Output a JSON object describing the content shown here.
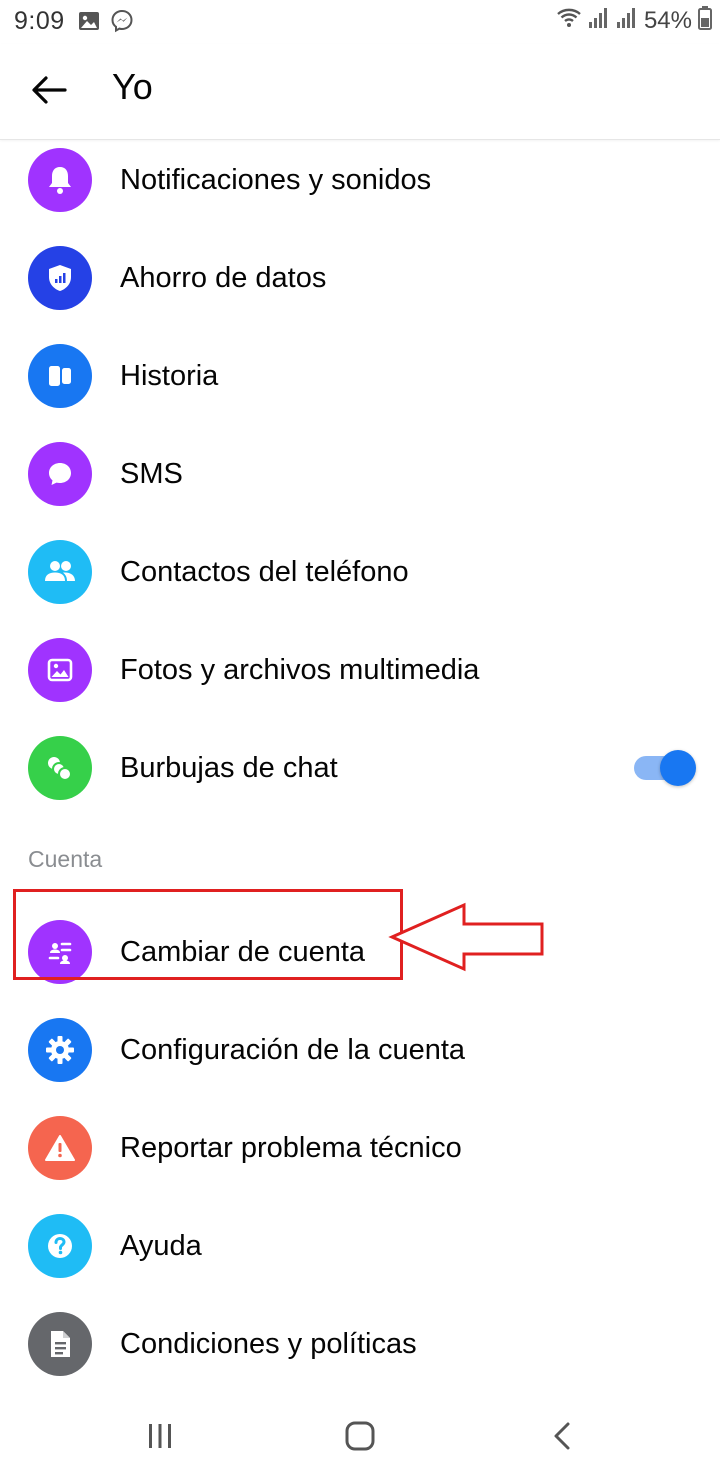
{
  "status_bar": {
    "time": "9:09",
    "battery": "54%",
    "icons_left": [
      "image-icon",
      "messenger-icon"
    ],
    "icons_right": [
      "wifi-icon",
      "signal-icon",
      "signal-icon",
      "battery-icon"
    ]
  },
  "header": {
    "title": "Yo",
    "back_icon": "arrow-left-icon"
  },
  "list": {
    "items": [
      {
        "label": "Notificaciones y sonidos",
        "icon": "bell-icon",
        "color": "#a033ff"
      },
      {
        "label": "Ahorro de datos",
        "icon": "shield-icon",
        "color": "#2541e6"
      },
      {
        "label": "Historia",
        "icon": "stories-icon",
        "color": "#1877f2"
      },
      {
        "label": "SMS",
        "icon": "chat-bubble-icon",
        "color": "#a033ff"
      },
      {
        "label": "Contactos del teléfono",
        "icon": "people-icon",
        "color": "#1fbcf5"
      },
      {
        "label": "Fotos y archivos multimedia",
        "icon": "photo-icon",
        "color": "#a033ff"
      },
      {
        "label": "Burbujas de chat",
        "icon": "chat-heads-icon",
        "color": "#36d04a",
        "toggle_on": true
      }
    ],
    "section_label": "Cuenta",
    "account_items": [
      {
        "label": "Cambiar de cuenta",
        "icon": "switch-account-icon",
        "color": "#a033ff"
      },
      {
        "label": "Configuración de la cuenta",
        "icon": "gear-icon",
        "color": "#1877f2"
      },
      {
        "label": "Reportar problema técnico",
        "icon": "warning-icon",
        "color": "#f5654f"
      },
      {
        "label": "Ayuda",
        "icon": "help-icon",
        "color": "#1fbcf5"
      },
      {
        "label": "Condiciones y políticas",
        "icon": "document-icon",
        "color": "#65676b"
      }
    ]
  },
  "annotation": {
    "highlight_color": "#e02020"
  },
  "nav_bar": {
    "buttons": [
      "recents-icon",
      "home-icon",
      "back-icon"
    ]
  }
}
